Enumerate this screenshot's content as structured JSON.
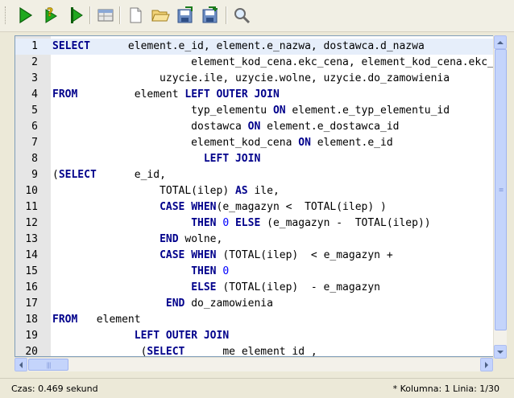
{
  "toolbar": {
    "buttons": [
      {
        "name": "run-icon"
      },
      {
        "name": "run-explain-icon"
      },
      {
        "name": "run-step-icon"
      },
      {
        "name": "grid-view-icon"
      },
      {
        "name": "new-file-icon"
      },
      {
        "name": "open-folder-icon"
      },
      {
        "name": "save-icon"
      },
      {
        "name": "save-as-icon"
      },
      {
        "name": "search-icon"
      }
    ]
  },
  "editor": {
    "current_line": 1,
    "lines": [
      {
        "n": "1",
        "segs": [
          {
            "t": "SELECT",
            "k": "kw"
          },
          {
            "t": "      element.e_id, element.e_nazwa, dostawca.d_nazwa",
            "k": ""
          }
        ]
      },
      {
        "n": "2",
        "segs": [
          {
            "t": "                      element_kod_cena.ekc_cena, element_kod_cena.ekc_kod,",
            "k": ""
          }
        ]
      },
      {
        "n": "3",
        "segs": [
          {
            "t": "                 uzycie.ile, uzycie.wolne, uzycie.do_zamowienia",
            "k": ""
          }
        ]
      },
      {
        "n": "4",
        "segs": [
          {
            "t": "FROM",
            "k": "kw"
          },
          {
            "t": "         element ",
            "k": ""
          },
          {
            "t": "LEFT OUTER JOIN",
            "k": "kw"
          }
        ]
      },
      {
        "n": "5",
        "segs": [
          {
            "t": "                      typ_elementu ",
            "k": ""
          },
          {
            "t": "ON",
            "k": "kw"
          },
          {
            "t": " element.e_typ_elementu_id",
            "k": ""
          }
        ]
      },
      {
        "n": "6",
        "segs": [
          {
            "t": "                      dostawca ",
            "k": ""
          },
          {
            "t": "ON",
            "k": "kw"
          },
          {
            "t": " element.e_dostawca_id",
            "k": ""
          }
        ]
      },
      {
        "n": "7",
        "segs": [
          {
            "t": "                      element_kod_cena ",
            "k": ""
          },
          {
            "t": "ON",
            "k": "kw"
          },
          {
            "t": " element.e_id",
            "k": ""
          }
        ]
      },
      {
        "n": "8",
        "segs": [
          {
            "t": "                        ",
            "k": ""
          },
          {
            "t": "LEFT JOIN",
            "k": "kw"
          }
        ]
      },
      {
        "n": "9",
        "segs": [
          {
            "t": "(",
            "k": ""
          },
          {
            "t": "SELECT",
            "k": "kw"
          },
          {
            "t": "      e_id,",
            "k": ""
          }
        ]
      },
      {
        "n": "10",
        "segs": [
          {
            "t": "                 TOTAL(ilep) ",
            "k": ""
          },
          {
            "t": "AS",
            "k": "kw"
          },
          {
            "t": " ile,",
            "k": ""
          }
        ]
      },
      {
        "n": "11",
        "segs": [
          {
            "t": "                 ",
            "k": ""
          },
          {
            "t": "CASE WHEN",
            "k": "kw"
          },
          {
            "t": "(e_magazyn <  TOTAL(ilep) )",
            "k": ""
          }
        ]
      },
      {
        "n": "12",
        "segs": [
          {
            "t": "                      ",
            "k": ""
          },
          {
            "t": "THEN",
            "k": "kw"
          },
          {
            "t": " ",
            "k": ""
          },
          {
            "t": "0",
            "k": "num"
          },
          {
            "t": " ",
            "k": ""
          },
          {
            "t": "ELSE",
            "k": "kw"
          },
          {
            "t": " (e_magazyn -  TOTAL(ilep))",
            "k": ""
          }
        ]
      },
      {
        "n": "13",
        "segs": [
          {
            "t": "                 ",
            "k": ""
          },
          {
            "t": "END",
            "k": "kw"
          },
          {
            "t": " wolne,",
            "k": ""
          }
        ]
      },
      {
        "n": "14",
        "segs": [
          {
            "t": "                 ",
            "k": ""
          },
          {
            "t": "CASE WHEN",
            "k": "kw"
          },
          {
            "t": " (TOTAL(ilep)  < e_magazyn + ",
            "k": ""
          }
        ]
      },
      {
        "n": "15",
        "segs": [
          {
            "t": "                      ",
            "k": ""
          },
          {
            "t": "THEN",
            "k": "kw"
          },
          {
            "t": " ",
            "k": ""
          },
          {
            "t": "0",
            "k": "num"
          }
        ]
      },
      {
        "n": "16",
        "segs": [
          {
            "t": "                      ",
            "k": ""
          },
          {
            "t": "ELSE",
            "k": "kw"
          },
          {
            "t": " (TOTAL(ilep)  - e_magazyn",
            "k": ""
          }
        ]
      },
      {
        "n": "17",
        "segs": [
          {
            "t": "                  ",
            "k": ""
          },
          {
            "t": "END",
            "k": "kw"
          },
          {
            "t": " do_zamowienia",
            "k": ""
          }
        ]
      },
      {
        "n": "18",
        "segs": [
          {
            "t": "FROM",
            "k": "kw"
          },
          {
            "t": "   element",
            "k": ""
          }
        ]
      },
      {
        "n": "19",
        "segs": [
          {
            "t": "             ",
            "k": ""
          },
          {
            "t": "LEFT OUTER JOIN",
            "k": "kw"
          }
        ]
      },
      {
        "n": "20",
        "segs": [
          {
            "t": "              (",
            "k": ""
          },
          {
            "t": "SELECT",
            "k": "kw"
          },
          {
            "t": "      me_element_id ,",
            "k": ""
          }
        ]
      }
    ]
  },
  "scrollbars": {
    "vertical_position": 0.0,
    "vertical_visible_fraction": 0.95,
    "horizontal_position": 0.0,
    "horizontal_visible_fraction": 0.09
  },
  "status": {
    "time_text": "Czas: 0.469 sekund",
    "cursor_text": "* Kolumna: 1 Linia: 1/30"
  }
}
